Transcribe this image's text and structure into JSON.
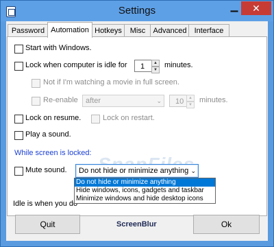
{
  "window": {
    "title": "Settings"
  },
  "titlebar": {
    "min_glyph": "▁",
    "close_glyph": "✕"
  },
  "tabs": [
    {
      "label": "Password",
      "active": false
    },
    {
      "label": "Automation",
      "active": true
    },
    {
      "label": "Hotkeys",
      "active": false
    },
    {
      "label": "Misc",
      "active": false
    },
    {
      "label": "Advanced",
      "active": false
    },
    {
      "label": "Interface",
      "active": false
    }
  ],
  "automation": {
    "start_with_windows": {
      "label": "Start with Windows.",
      "checked": false
    },
    "lock_idle": {
      "label_before": "Lock when computer is idle for",
      "value": "1",
      "label_after": "minutes.",
      "checked": false
    },
    "not_if_movie": {
      "label": "Not if I'm watching a movie in full screen.",
      "checked": false,
      "enabled": false
    },
    "reenable": {
      "label": "Re-enable",
      "select_value": "after",
      "spin_value": "10",
      "unit": "minutes.",
      "checked": false,
      "enabled": false
    },
    "lock_on_resume": {
      "label": "Lock on resume.",
      "checked": false
    },
    "lock_on_restart": {
      "label": "Lock on restart.",
      "checked": false,
      "enabled": false
    },
    "play_sound": {
      "label": "Play a sound.",
      "checked": false
    },
    "section_title": "While screen is locked:",
    "mute_sound": {
      "label": "Mute sound.",
      "checked": false
    },
    "lock_mode": {
      "selected": "Do not hide or minimize anything",
      "options": [
        "Do not hide or minimize anything",
        "Hide windows, icons, gadgets and taskbar",
        "Minimize windows and hide desktop icons"
      ]
    },
    "idle_note_visible": "Idle is when you do"
  },
  "footer": {
    "quit_label": "Quit",
    "brand": "ScreenBlur",
    "ok_label": "Ok"
  },
  "watermark": "SnapFiles",
  "colors": {
    "title_bar": "#5ea0e6",
    "close": "#c73b35",
    "section_text": "#1a3fd2",
    "selection": "#0078d7"
  }
}
